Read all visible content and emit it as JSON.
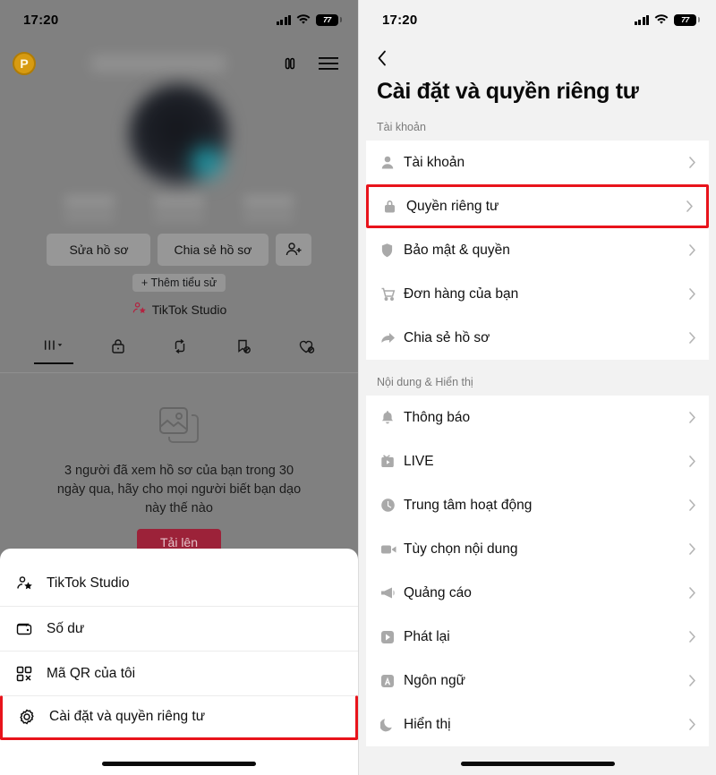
{
  "status_bar": {
    "time": "17:20",
    "battery_percent": "77",
    "signal_icon": "cellular-bars-icon",
    "wifi_icon": "wifi-icon",
    "battery_icon": "battery-icon"
  },
  "left_screen": {
    "profile": {
      "badge_letter": "P",
      "threads_icon": "threads-icon",
      "menu_icon": "hamburger-menu-icon",
      "actions": [
        {
          "label": "Sửa hồ sơ",
          "name": "edit-profile-button"
        },
        {
          "label": "Chia sẻ hồ sơ",
          "name": "share-profile-button"
        }
      ],
      "add_friend_icon": "add-person-icon",
      "bio_chip": "+ Thêm tiểu sử",
      "studio_label": "TikTok Studio",
      "studio_icon": "person-star-icon",
      "tabs": [
        {
          "name": "tab-grid",
          "icon": "grid-dropdown-icon",
          "active": true
        },
        {
          "name": "tab-private",
          "icon": "lock-icon",
          "active": false
        },
        {
          "name": "tab-reposts",
          "icon": "repost-icon",
          "active": false
        },
        {
          "name": "tab-saved",
          "icon": "bookmark-hidden-icon",
          "active": false
        },
        {
          "name": "tab-liked",
          "icon": "heart-hidden-icon",
          "active": false
        }
      ]
    },
    "empty_state": {
      "icon": "photo-stack-icon",
      "message": "3 người đã xem hồ sơ của bạn trong 30 ngày qua, hãy cho mọi người biết bạn dạo này thế nào",
      "button_label": "Tải lên"
    },
    "sheet": {
      "items": [
        {
          "label": "TikTok Studio",
          "icon": "person-star-icon",
          "name": "sheet-item-tiktok-studio",
          "highlighted": false
        },
        {
          "label": "Số dư",
          "icon": "wallet-icon",
          "name": "sheet-item-balance",
          "highlighted": false
        },
        {
          "label": "Mã QR của tôi",
          "icon": "qr-code-icon",
          "name": "sheet-item-my-qr",
          "highlighted": false
        },
        {
          "label": "Cài đặt và quyền riêng tư",
          "icon": "gear-icon",
          "name": "sheet-item-settings-privacy",
          "highlighted": true
        }
      ]
    }
  },
  "right_screen": {
    "back_icon": "chevron-left-icon",
    "title": "Cài đặt và quyền riêng tư",
    "sections": [
      {
        "label": "Tài khoản",
        "name": "section-account",
        "items": [
          {
            "label": "Tài khoản",
            "icon": "person-icon",
            "name": "settings-row-account",
            "highlighted": false
          },
          {
            "label": "Quyền riêng tư",
            "icon": "lock-icon",
            "name": "settings-row-privacy",
            "highlighted": true
          },
          {
            "label": "Bảo mật & quyền",
            "icon": "shield-icon",
            "name": "settings-row-security-permissions",
            "highlighted": false
          },
          {
            "label": "Đơn hàng của bạn",
            "icon": "shopping-cart-icon",
            "name": "settings-row-your-orders",
            "highlighted": false
          },
          {
            "label": "Chia sẻ hồ sơ",
            "icon": "share-arrow-icon",
            "name": "settings-row-share-profile",
            "highlighted": false
          }
        ]
      },
      {
        "label": "Nội dung & Hiển thị",
        "name": "section-content-display",
        "items": [
          {
            "label": "Thông báo",
            "icon": "bell-icon",
            "name": "settings-row-notifications",
            "highlighted": false
          },
          {
            "label": "LIVE",
            "icon": "live-tv-icon",
            "name": "settings-row-live",
            "highlighted": false
          },
          {
            "label": "Trung tâm hoạt động",
            "icon": "clock-icon",
            "name": "settings-row-activity-center",
            "highlighted": false
          },
          {
            "label": "Tùy chọn nội dung",
            "icon": "video-camera-icon",
            "name": "settings-row-content-preferences",
            "highlighted": false
          },
          {
            "label": "Quảng cáo",
            "icon": "megaphone-icon",
            "name": "settings-row-ads",
            "highlighted": false
          },
          {
            "label": "Phát lại",
            "icon": "play-box-icon",
            "name": "settings-row-playback",
            "highlighted": false
          },
          {
            "label": "Ngôn ngữ",
            "icon": "language-a-icon",
            "name": "settings-row-language",
            "highlighted": false
          },
          {
            "label": "Hiển thị",
            "icon": "moon-icon",
            "name": "settings-row-display",
            "highlighted": false
          }
        ]
      }
    ]
  },
  "colors": {
    "highlight_red": "#e8131b",
    "upload_button": "#9c2239",
    "dim_overlay": "#808080",
    "page_bg": "#f2f2f2"
  }
}
